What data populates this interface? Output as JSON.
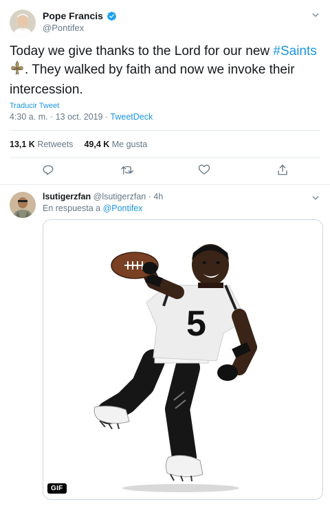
{
  "tweet": {
    "author_name": "Pope Francis",
    "author_handle": "@Pontifex",
    "text_before": "Today we give thanks to the Lord for our new ",
    "hashtag": "#Saints",
    "text_after": ". They walked by faith and now we invoke their intercession.",
    "translate_label": "Traducir Tweet",
    "timestamp": "4:30 a. m. · 13 oct. 2019 · ",
    "client": "TweetDeck",
    "retweets_count": "13,1 K",
    "retweets_label": "Retweets",
    "likes_count": "49,4 K",
    "likes_label": "Me gusta"
  },
  "reply": {
    "author_name": "lsutigerzfan",
    "author_handle": "@lsutigerzfan",
    "time_ago": " · 4h",
    "reply_to_prefix": "En respuesta a ",
    "reply_to_handle": "@Pontifex",
    "media_badge": "GIF",
    "jersey_number": "5"
  },
  "icons": {
    "verified": "verified-badge-icon",
    "caret": "chevron-down-icon",
    "reply": "reply-icon",
    "retweet": "retweet-icon",
    "like": "heart-icon",
    "share": "share-icon"
  },
  "colors": {
    "link": "#1b95e0",
    "secondary": "#657786",
    "border": "#e6ecf0",
    "saints_gold": "#b99a5c"
  }
}
